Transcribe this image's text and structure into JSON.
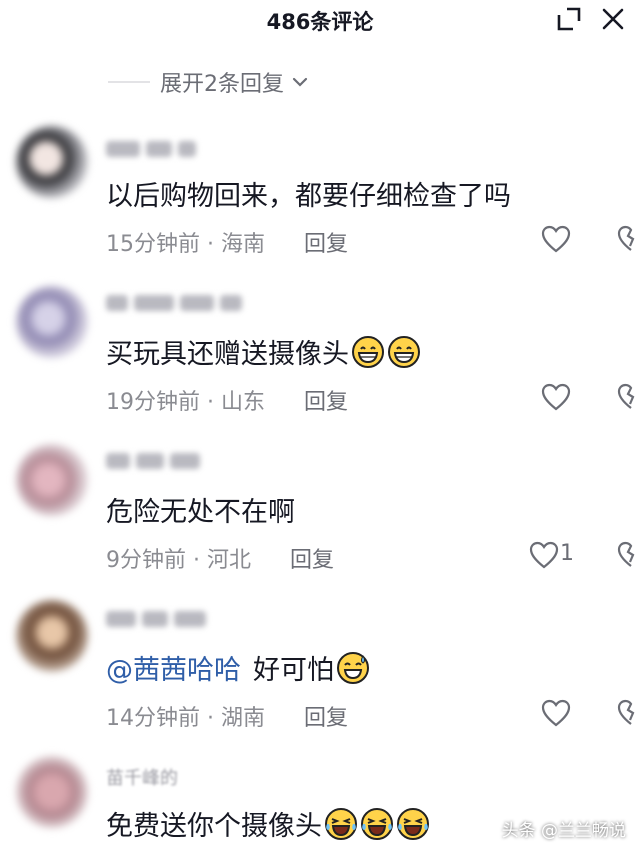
{
  "header": {
    "title": "486条评论"
  },
  "expand_replies": {
    "label": "展开2条回复"
  },
  "comments": [
    {
      "text": "以后购物回来，都要仔细检查了吗",
      "time": "15分钟前",
      "region": "海南",
      "reply": "回复",
      "likes": ""
    },
    {
      "text": "买玩具还赠送摄像头",
      "time": "19分钟前",
      "region": "山东",
      "reply": "回复",
      "likes": "",
      "emojis": [
        "grin-emoji",
        "grin-emoji"
      ]
    },
    {
      "text": "危险无处不在啊",
      "time": "9分钟前",
      "region": "河北",
      "reply": "回复",
      "likes": "1"
    },
    {
      "mention": "@茜茜哈哈",
      "text": "好可怕",
      "time": "14分钟前",
      "region": "湖南",
      "reply": "回复",
      "likes": "",
      "emojis": [
        "sweat-smile-emoji"
      ]
    },
    {
      "username": "苗千峰的",
      "text": "免费送你个摄像头",
      "emojis": [
        "laugh-cry-emoji",
        "laugh-cry-emoji",
        "laugh-cry-emoji"
      ]
    }
  ],
  "watermark": "头条 @兰兰畅说",
  "colors": {
    "mention": "#2f5ea8",
    "meta": "#8a8b91",
    "text": "#161823"
  }
}
